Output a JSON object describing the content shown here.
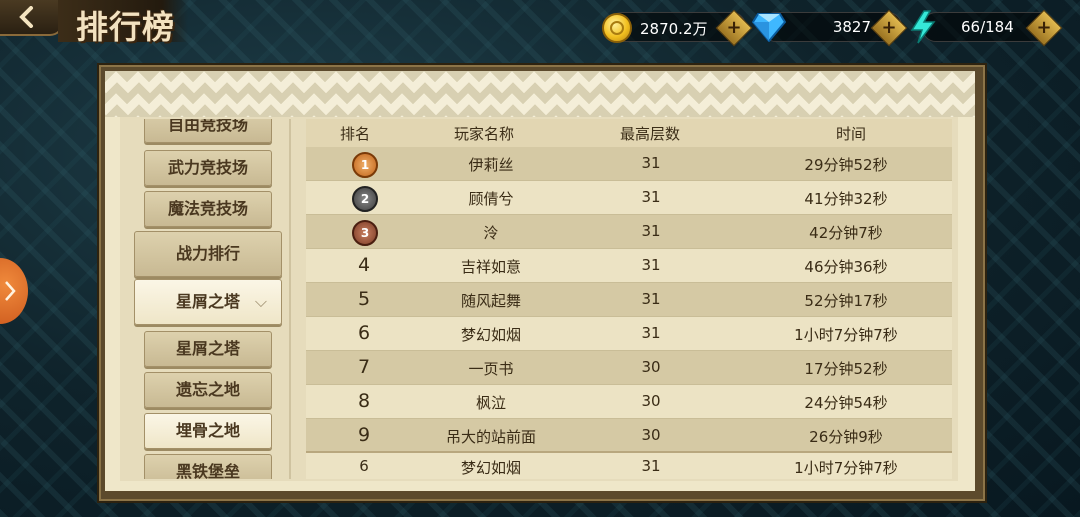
{
  "header": {
    "title": "排行榜",
    "gold": "2870.2万",
    "diamonds": "3827",
    "stamina": "66/184"
  },
  "menu": [
    {
      "label": "自由竞技场",
      "state": "partial"
    },
    {
      "label": "武力竞技场",
      "state": "normal"
    },
    {
      "label": "魔法竞技场",
      "state": "normal"
    },
    {
      "label": "战力排行",
      "state": "category"
    },
    {
      "label": "星屑之塔",
      "state": "category-selected"
    },
    {
      "label": "星屑之塔",
      "state": "normal"
    },
    {
      "label": "遗忘之地",
      "state": "normal"
    },
    {
      "label": "埋骨之地",
      "state": "selected"
    },
    {
      "label": "黑铁堡垒",
      "state": "partial"
    }
  ],
  "table": {
    "headers": {
      "rank": "排名",
      "name": "玩家名称",
      "floor": "最高层数",
      "time": "时间"
    },
    "rows": [
      {
        "rank": "1",
        "medal": "gold",
        "name": "伊莉丝",
        "floor": "31",
        "time": "29分钟52秒"
      },
      {
        "rank": "2",
        "medal": "silver",
        "name": "顾倩兮",
        "floor": "31",
        "time": "41分钟32秒"
      },
      {
        "rank": "3",
        "medal": "bronze",
        "name": "泠",
        "floor": "31",
        "time": "42分钟7秒"
      },
      {
        "rank": "4",
        "name": "吉祥如意",
        "floor": "31",
        "time": "46分钟36秒"
      },
      {
        "rank": "5",
        "name": "随风起舞",
        "floor": "31",
        "time": "52分钟17秒"
      },
      {
        "rank": "6",
        "name": "梦幻如烟",
        "floor": "31",
        "time": "1小时7分钟7秒"
      },
      {
        "rank": "7",
        "name": "一页书",
        "floor": "30",
        "time": "17分钟52秒"
      },
      {
        "rank": "8",
        "name": "枫泣",
        "floor": "30",
        "time": "24分钟54秒"
      },
      {
        "rank": "9",
        "name": "吊大的站前面",
        "floor": "30",
        "time": "26分钟9秒"
      }
    ],
    "my_row": {
      "rank": "6",
      "name": "梦幻如烟",
      "floor": "31",
      "time": "1小时7分钟7秒"
    }
  },
  "colors": {
    "accent": "#c9551a",
    "panel": "#efe7c9",
    "row_dark": "#d5c9a4"
  }
}
